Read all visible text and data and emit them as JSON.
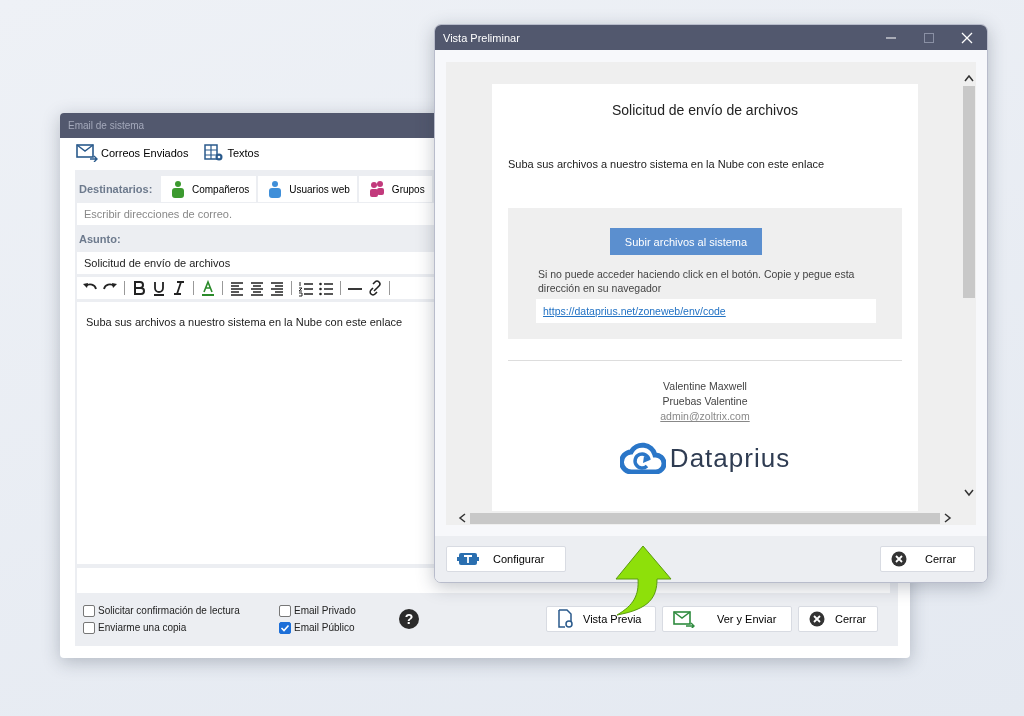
{
  "email_window": {
    "title": "Email de sistema",
    "toolbar": [
      {
        "label": "Correos Enviados",
        "kind": "mail"
      },
      {
        "label": "Textos",
        "kind": "grid"
      }
    ],
    "recipients": {
      "label": "Destinatarios:",
      "buttons": [
        {
          "label": "Compañeros",
          "color": "#3c9a2f"
        },
        {
          "label": "Usuarios web",
          "color": "#3f8fd9"
        },
        {
          "label": "Grupos",
          "color": "#c23a7c"
        }
      ]
    },
    "address_field": {
      "placeholder": "Escribir direcciones de correo."
    },
    "subject": {
      "label": "Asunto:",
      "value": "Solicitud de envío de archivos"
    },
    "body": "Suba sus archivos a nuestro sistema en la Nube con este enlace",
    "options": [
      [
        {
          "label": "Solicitar confirmación de lectura",
          "checked": false
        },
        {
          "label": "Enviarme una copia",
          "checked": false
        }
      ],
      [
        {
          "label": "Email Privado",
          "checked": false
        },
        {
          "label": "Email Público",
          "checked": true
        }
      ]
    ],
    "help": "?",
    "buttons": [
      {
        "label": "Vista Previa",
        "kind": "preview"
      },
      {
        "label": "Ver y Enviar",
        "kind": "send"
      },
      {
        "label": "Cerrar",
        "kind": "close"
      }
    ]
  },
  "preview_window": {
    "title": "Vista Preliminar",
    "email": {
      "title": "Solicitud de envío de archivos",
      "intro": "Suba sus archivos a nuestro sistema en la Nube con este enlace",
      "button": "Subir archivos al sistema",
      "note": "Si no puede acceder haciendo click en el botón. Copie y pegue esta dirección en su navegador",
      "link": "https://dataprius.net/zoneweb/env/code",
      "signature": [
        "Valentine Maxwell",
        "Pruebas Valentine"
      ],
      "signature_email": "admin@zoltrix.com",
      "logo_text": "Dataprius"
    },
    "buttons": [
      {
        "label": "Configurar",
        "kind": "config"
      },
      {
        "label": "Cerrar",
        "kind": "close"
      }
    ]
  }
}
